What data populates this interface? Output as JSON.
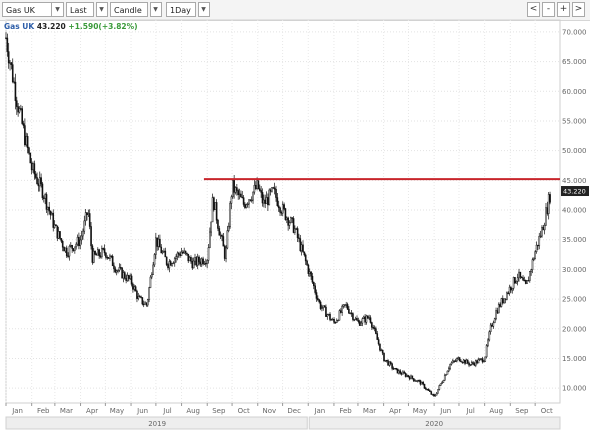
{
  "toolbar": {
    "symbol_value": "Gas UK",
    "price_type_value": "Last",
    "chart_type_value": "Candle",
    "interval_value": "1Day",
    "nav_buttons": [
      "<",
      "-",
      "+",
      ">"
    ]
  },
  "legend": {
    "name": "Gas UK",
    "last": "43.220",
    "change": "+1.590(+3.82%)"
  },
  "price_tag": "43.220",
  "colors": {
    "candle": "#111111",
    "resistance_line": "#c8252b",
    "price_tag_bg": "#222222",
    "legend_name": "#2c5da8",
    "legend_change": "#3a9a3a"
  },
  "chart_data": {
    "type": "line",
    "title": "",
    "ylim": [
      7.5,
      72
    ],
    "y_ticks": [
      "70.000",
      "65.000",
      "60.000",
      "55.000",
      "50.000",
      "45.000",
      "40.000",
      "35.000",
      "30.000",
      "25.000",
      "20.000",
      "15.000",
      "10.000"
    ],
    "x_ticks": [
      "Jan",
      "Feb",
      "Mar",
      "Apr",
      "May",
      "Jun",
      "Jul",
      "Aug",
      "Sep",
      "Oct",
      "Nov",
      "Dec",
      "Jan",
      "Feb",
      "Mar",
      "Apr",
      "May",
      "Jun",
      "Jul",
      "Aug",
      "Sep",
      "Oct"
    ],
    "x_groups": [
      "2019",
      "2020"
    ],
    "resistance_level": 45.2,
    "series": [
      {
        "x": [
          "2019-01-01",
          "2019-01-15",
          "2019-02-01",
          "2019-02-15",
          "2019-03-01",
          "2019-03-15",
          "2019-04-01",
          "2019-04-10",
          "2019-04-15",
          "2019-05-01",
          "2019-05-15",
          "2019-06-01",
          "2019-06-10",
          "2019-06-20",
          "2019-07-01",
          "2019-07-15",
          "2019-08-01",
          "2019-08-15",
          "2019-09-01",
          "2019-09-08",
          "2019-09-15",
          "2019-09-23",
          "2019-10-01",
          "2019-10-15",
          "2019-11-01",
          "2019-11-08",
          "2019-11-20",
          "2019-12-01",
          "2019-12-15",
          "2020-01-01",
          "2020-01-15",
          "2020-02-01",
          "2020-02-15",
          "2020-03-01",
          "2020-03-15",
          "2020-04-01",
          "2020-04-15",
          "2020-05-01",
          "2020-05-15",
          "2020-06-01",
          "2020-06-10",
          "2020-06-20",
          "2020-07-01",
          "2020-07-15",
          "2020-08-01",
          "2020-08-08",
          "2020-08-15",
          "2020-09-01",
          "2020-09-10",
          "2020-09-20",
          "2020-10-01",
          "2020-10-10",
          "2020-10-20"
        ],
        "y": [
          69,
          58,
          47,
          43,
          37,
          33,
          35,
          40,
          32,
          33,
          30,
          28,
          25,
          24,
          35,
          31,
          33,
          31,
          32,
          42,
          37,
          32,
          44,
          41,
          44,
          41,
          43,
          40,
          37,
          30,
          24,
          21,
          24,
          21,
          22,
          15,
          13,
          12,
          11,
          8.5,
          11,
          14,
          15,
          14,
          15,
          20,
          23,
          27,
          29,
          27,
          33,
          37,
          43.2
        ]
      }
    ]
  }
}
